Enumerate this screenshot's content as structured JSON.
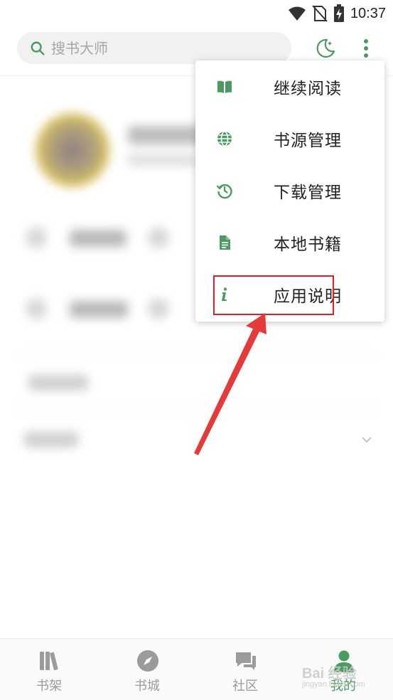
{
  "status_bar": {
    "time": "10:37"
  },
  "search": {
    "placeholder": "搜书大师"
  },
  "colors": {
    "accent": "#4a9a61",
    "highlight": "#e02020"
  },
  "menu": {
    "items": [
      {
        "label": "继续阅读",
        "icon": "book-open-icon"
      },
      {
        "label": "书源管理",
        "icon": "globe-icon"
      },
      {
        "label": "下载管理",
        "icon": "history-icon"
      },
      {
        "label": "本地书籍",
        "icon": "document-icon"
      },
      {
        "label": "应用说明",
        "icon": "info-icon"
      }
    ]
  },
  "bottom_nav": {
    "items": [
      {
        "label": "书架",
        "icon": "bookshelf-icon",
        "active": false
      },
      {
        "label": "书城",
        "icon": "compass-icon",
        "active": false
      },
      {
        "label": "社区",
        "icon": "chat-bubbles-icon",
        "active": false
      },
      {
        "label": "我的",
        "icon": "user-icon",
        "active": true
      }
    ]
  },
  "watermark": {
    "text": "Bai 经验",
    "sub": "jingyan.baidu.com"
  }
}
